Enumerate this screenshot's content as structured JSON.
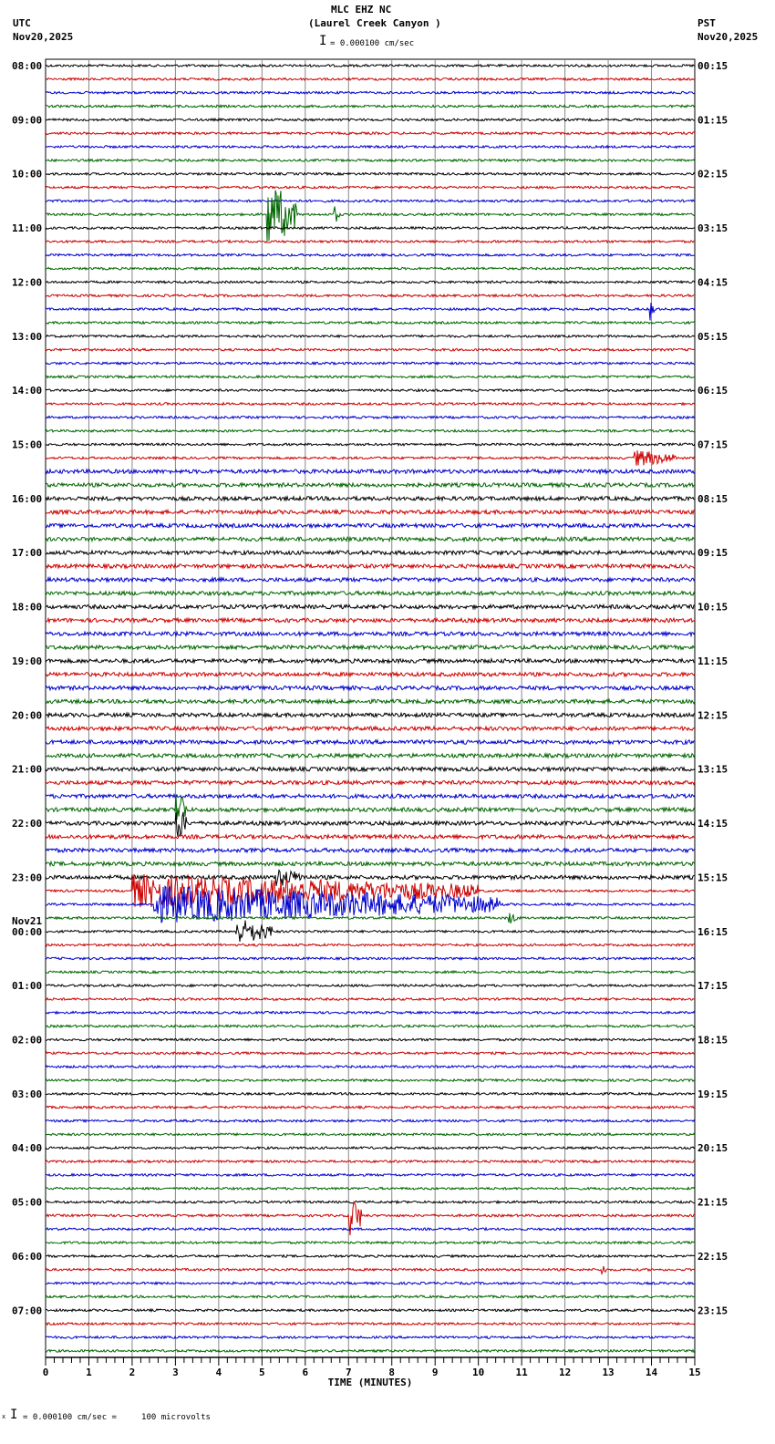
{
  "header": {
    "station": "MLC EHZ NC",
    "site": "(Laurel Creek Canyon )",
    "left_tz": "UTC",
    "left_date": "Nov20,2025",
    "right_tz": "PST",
    "right_date": "Nov20,2025",
    "scale_text": "= 0.000100 cm/sec"
  },
  "footer": {
    "scale_text": "= 0.000100 cm/sec =     100 microvolts",
    "prefix": "x"
  },
  "chart_data": {
    "type": "line",
    "title": "MLC EHZ NC (Laurel Creek Canyon )",
    "xlabel": "TIME (MINUTES)",
    "xlim": [
      0,
      15
    ],
    "xticks": [
      "0",
      "1",
      "2",
      "3",
      "4",
      "5",
      "6",
      "7",
      "8",
      "9",
      "10",
      "11",
      "12",
      "13",
      "14",
      "15"
    ],
    "grid": true,
    "trace_colors": [
      "#000000",
      "#cc0000",
      "#0000cc",
      "#006600"
    ],
    "traces_per_hour": 4,
    "left_hour_labels": [
      "08:00",
      "09:00",
      "10:00",
      "11:00",
      "12:00",
      "13:00",
      "14:00",
      "15:00",
      "16:00",
      "17:00",
      "18:00",
      "19:00",
      "20:00",
      "21:00",
      "22:00",
      "23:00",
      "00:00",
      "01:00",
      "02:00",
      "03:00",
      "04:00",
      "05:00",
      "06:00",
      "07:00"
    ],
    "date_change_label": "Nov21",
    "right_hour_labels": [
      "00:15",
      "01:15",
      "02:15",
      "03:15",
      "04:15",
      "05:15",
      "06:15",
      "07:15",
      "08:15",
      "09:15",
      "10:15",
      "11:15",
      "12:15",
      "13:15",
      "14:15",
      "15:15",
      "16:15",
      "17:15",
      "18:15",
      "19:15",
      "20:15",
      "21:15",
      "22:15",
      "23:15"
    ],
    "noisy_trace_range": [
      30,
      60
    ],
    "events": [
      {
        "trace": 11,
        "start_min": 5.1,
        "end_min": 5.8,
        "amplitude": 5
      },
      {
        "trace": 11,
        "start_min": 6.65,
        "end_min": 6.8,
        "amplitude": 1.5
      },
      {
        "trace": 18,
        "start_min": 13.95,
        "end_min": 14.1,
        "amplitude": 1.8
      },
      {
        "trace": 29,
        "start_min": 13.6,
        "end_min": 14.6,
        "amplitude": 1.3
      },
      {
        "trace": 55,
        "start_min": 3.0,
        "end_min": 3.25,
        "amplitude": 4
      },
      {
        "trace": 56,
        "start_min": 3.0,
        "end_min": 3.25,
        "amplitude": 3
      },
      {
        "trace": 60,
        "start_min": 5.3,
        "end_min": 6.0,
        "amplitude": 1.5
      },
      {
        "trace": 61,
        "start_min": 2.0,
        "end_min": 10.0,
        "amplitude": 2.5
      },
      {
        "trace": 62,
        "start_min": 2.5,
        "end_min": 10.5,
        "amplitude": 2.8
      },
      {
        "trace": 63,
        "start_min": 10.7,
        "end_min": 10.9,
        "amplitude": 1.0
      },
      {
        "trace": 64,
        "start_min": 4.4,
        "end_min": 5.3,
        "amplitude": 2
      },
      {
        "trace": 85,
        "start_min": 7.0,
        "end_min": 7.3,
        "amplitude": 3.5
      },
      {
        "trace": 89,
        "start_min": 12.85,
        "end_min": 12.95,
        "amplitude": 1.0
      }
    ]
  }
}
